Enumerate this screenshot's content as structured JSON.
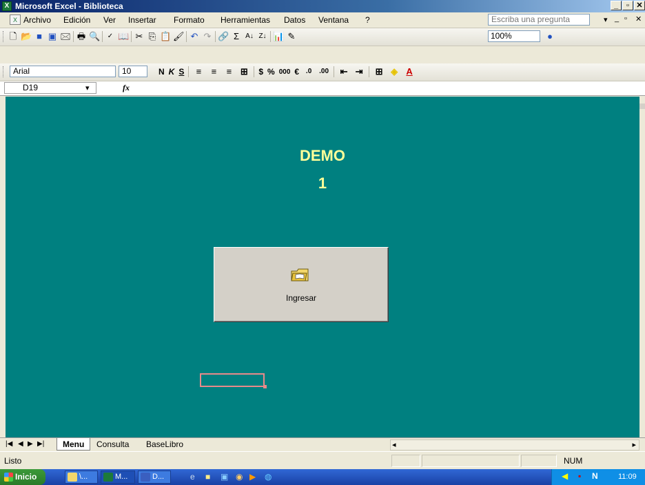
{
  "window": {
    "title": "Microsoft Excel - Biblioteca",
    "icon": "excel-icon"
  },
  "menus": [
    "Archivo",
    "Edición",
    "Ver",
    "Insertar",
    "Formato",
    "Herramientas",
    "Datos",
    "Ventana",
    "?"
  ],
  "ask_placeholder": "Escriba una pregunta",
  "toolbar": {
    "zoom": "100%"
  },
  "format": {
    "font": "Arial",
    "size": "10",
    "bold": "N",
    "italic": "K",
    "underline": "S",
    "currency": "$",
    "percent": "%",
    "thousands": "000",
    "euro": "€"
  },
  "formula": {
    "cell": "D19",
    "fx": "fx",
    "value": ""
  },
  "sheet": {
    "heading": "DEMO",
    "subheading": "1",
    "button_label": "Ingresar",
    "background": "#008080",
    "heading_color": "#ffff99"
  },
  "tabs": [
    "Menu",
    "Consulta",
    "BaseLibro"
  ],
  "status": {
    "text": "Listo",
    "mode": "NUM"
  },
  "taskbar": {
    "start": "Inicio",
    "buttons": [
      "\\...",
      "M...",
      "D..."
    ],
    "clock": "11:09"
  }
}
